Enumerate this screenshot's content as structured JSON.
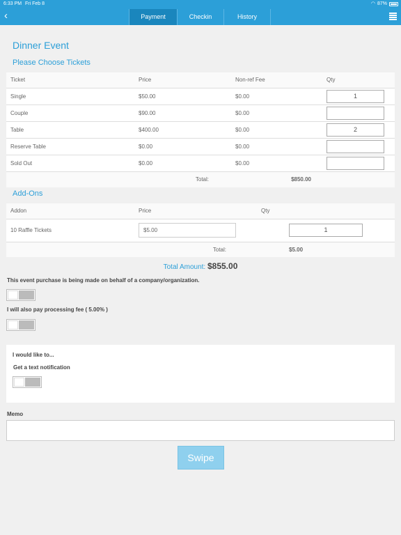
{
  "status": {
    "time": "6:33 PM",
    "date": "Fri Feb 8",
    "battery": "87%"
  },
  "nav": {
    "back_icon": "chevron-left-icon",
    "tabs": [
      "Payment",
      "Checkin",
      "History"
    ],
    "active_tab": "Payment",
    "menu_icon": "list-icon"
  },
  "event": {
    "title": "Dinner Event",
    "subtitle": "Please Choose Tickets"
  },
  "tickets": {
    "headers": [
      "Ticket",
      "Price",
      "Non-ref Fee",
      "Qty"
    ],
    "rows": [
      {
        "name": "Single",
        "price": "$50.00",
        "fee": "$0.00",
        "qty": "1"
      },
      {
        "name": "Couple",
        "price": "$90.00",
        "fee": "$0.00",
        "qty": ""
      },
      {
        "name": "Table",
        "price": "$400.00",
        "fee": "$0.00",
        "qty": "2"
      },
      {
        "name": "Reserve Table",
        "price": "$0.00",
        "fee": "$0.00",
        "qty": ""
      },
      {
        "name": "Sold Out",
        "price": "$0.00",
        "fee": "$0.00",
        "qty": ""
      }
    ],
    "total_label": "Total:",
    "total_value": "$850.00"
  },
  "addons": {
    "title": "Add-Ons",
    "headers": [
      "Addon",
      "Price",
      "Qty"
    ],
    "rows": [
      {
        "name": "10 Raffle Tickets",
        "price": "$5.00",
        "qty": "1"
      }
    ],
    "total_label": "Total:",
    "total_value": "$5.00"
  },
  "summary": {
    "label": "Total Amount:",
    "value": "$855.00"
  },
  "options": {
    "behalf_label": "This event purchase is being made on behalf of a company/organization.",
    "fee_label": "I will also pay processing fee ( 5.00% )",
    "notify_heading": "I would like to...",
    "notify_label": "Get a text notification"
  },
  "memo": {
    "label": "Memo",
    "value": ""
  },
  "swipe_label": "Swipe"
}
